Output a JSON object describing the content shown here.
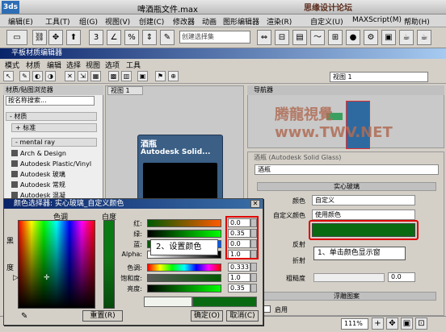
{
  "app": {
    "title": "啤酒瓶文件.max",
    "watermark_top": "思缘设计论坛",
    "watermark_mid": "腾龍視覺 www.TWV.NET",
    "logo_text": "3ds"
  },
  "menubar": [
    "编辑(E)",
    "工具(T)",
    "组(G)",
    "视图(V)",
    "创建(C)",
    "修改器",
    "动画",
    "图形编辑器",
    "渲染(R)",
    "自定义(U)",
    "MAXScript(M)",
    "帮助(H)"
  ],
  "toolbar": {
    "selection_set_placeholder": "创建选择集"
  },
  "material_editor": {
    "title": "平板材质编辑器",
    "menu": [
      "模式",
      "材质",
      "编辑",
      "选择",
      "视图",
      "选项",
      "工具"
    ],
    "view_select": "视图 1"
  },
  "browser": {
    "header": "材质/贴图浏览器",
    "search_placeholder": "按名称搜索...",
    "cat_materials": "- 材质",
    "cat_standard": "+ 标准",
    "cat_mentalray": "- mental ray",
    "items": [
      "Arch & Design",
      "Autodesk Plastic/Vinyl",
      "Autodesk 玻璃",
      "Autodesk 常规",
      "Autodesk 混凝"
    ]
  },
  "view": {
    "tab": "视图 1",
    "node_title": "酒瓶",
    "node_sub": "Autodesk Solid..."
  },
  "navigator": {
    "header": "导航器"
  },
  "params": {
    "header": "酒瓶  (Autodesk Solid Glass)",
    "material_name": "酒瓶",
    "rollout_solid_glass": "实心玻璃",
    "color_label": "颜色",
    "color_value": "自定义",
    "custom_color_label": "自定义颜色",
    "custom_color_value": "使用颜色",
    "reflect_label": "反射",
    "refract_label": "折射",
    "roughness_label": "粗糙度",
    "roughness_value": "0.0",
    "rollout_bump": "浮雕图案",
    "enable_label": "启用",
    "swatch_color": "#0a6a12"
  },
  "callouts": {
    "step1": "1、单击颜色显示窗",
    "step2": "2、设置颜色"
  },
  "color_selector": {
    "title": "颜色选择器: 实心玻璃_自定义颜色",
    "hue_label": "色调",
    "whiteness_label": "白度",
    "black_label": "黑",
    "degree_label": "度",
    "red_label": "红:",
    "green_label": "绿:",
    "blue_label": "蓝:",
    "alpha_label": "Alpha:",
    "red_value": "0.0",
    "green_value": "0.35",
    "blue_value": "0.0",
    "alpha_value": "1.0",
    "hue_label2": "色调:",
    "sat_label": "饱和度:",
    "val_label": "亮度:",
    "hue_value": "0.333",
    "sat_value": "1.0",
    "val_value": "0.35",
    "reset": "重置(R)",
    "ok": "确定(O)",
    "cancel": "取消(C)",
    "new_color": "#0a6a12"
  },
  "status": {
    "zoom": "111%"
  }
}
